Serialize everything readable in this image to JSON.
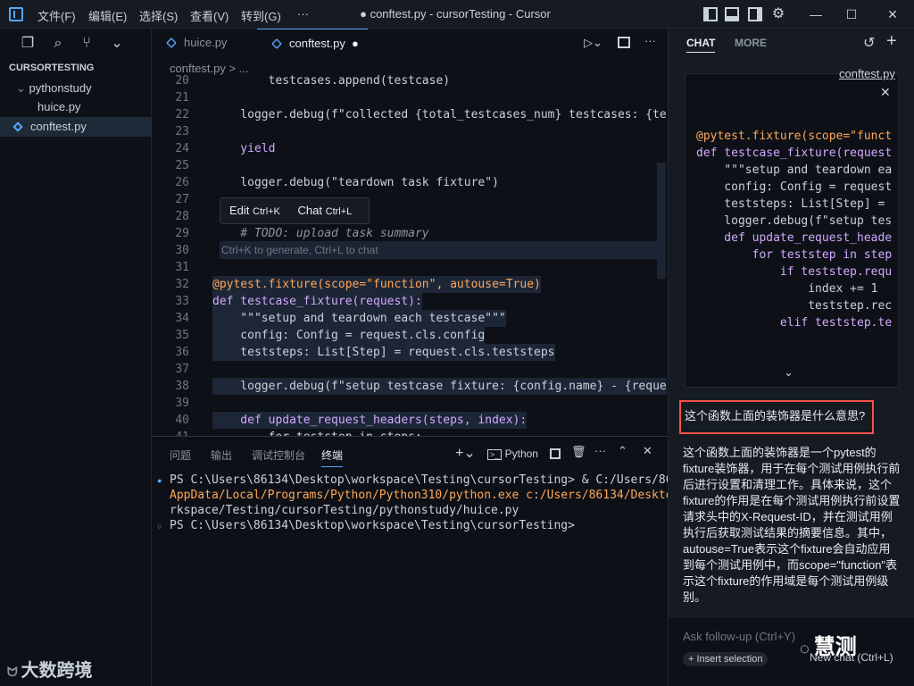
{
  "titlebar": {
    "menus": [
      "文件(F)",
      "编辑(E)",
      "选择(S)",
      "查看(V)",
      "转到(G)",
      "···"
    ],
    "title": "● conftest.py - cursorTesting - Cursor"
  },
  "explorer": {
    "section": "CURSORTESTING",
    "folder": "pythonstudy",
    "files": [
      "huice.py",
      "conftest.py"
    ]
  },
  "editor": {
    "tabs": [
      "huice.py",
      "conftest.py"
    ],
    "breadcrumb": "conftest.py > ...",
    "hint": "Ctrl+K to generate, Ctrl+L to chat",
    "popup": {
      "edit": "Edit",
      "edit_key": "Ctrl+K",
      "chat": "Chat",
      "chat_key": "Ctrl+L"
    },
    "lines": [
      {
        "n": "20",
        "t": "        testcases.append(testcase)"
      },
      {
        "n": "21",
        "t": ""
      },
      {
        "n": "22",
        "t": "    logger.debug(f\"collected {total_testcases_num} testcases: {te"
      },
      {
        "n": "23",
        "t": ""
      },
      {
        "n": "24",
        "t": "    yield"
      },
      {
        "n": "25",
        "t": ""
      },
      {
        "n": "26",
        "t": "    logger.debug(\"teardown task fixture\")"
      },
      {
        "n": "27",
        "t": ""
      },
      {
        "n": "28",
        "t": ""
      },
      {
        "n": "29",
        "t": "    # TODO: upload task summary"
      },
      {
        "n": "30",
        "t": ""
      },
      {
        "n": "31",
        "t": ""
      },
      {
        "n": "32",
        "t": "@pytest.fixture(scope=\"function\", autouse=True)"
      },
      {
        "n": "33",
        "t": "def testcase_fixture(request):"
      },
      {
        "n": "34",
        "t": "    \"\"\"setup and teardown each testcase\"\"\""
      },
      {
        "n": "35",
        "t": "    config: Config = request.cls.config"
      },
      {
        "n": "36",
        "t": "    teststeps: List[Step] = request.cls.teststeps"
      },
      {
        "n": "37",
        "t": ""
      },
      {
        "n": "38",
        "t": "    logger.debug(f\"setup testcase fixture: {config.name} - {reque"
      },
      {
        "n": "39",
        "t": ""
      },
      {
        "n": "40",
        "t": "    def update_request_headers(steps, index):"
      },
      {
        "n": "41",
        "t": "        for teststep in steps:"
      }
    ]
  },
  "terminal": {
    "tabs": [
      "问题",
      "输出",
      "调试控制台",
      "终端"
    ],
    "shell": "Python",
    "lines": [
      "PS C:\\Users\\86134\\Desktop\\workspace\\Testing\\cursorTesting> & C:/Users/86134/",
      "AppData/Local/Programs/Python/Python310/python.exe c:/Users/86134/Desktop/wo",
      "rkspace/Testing/cursorTesting/pythonstudy/huice.py",
      "PS C:\\Users\\86134\\Desktop\\workspace\\Testing\\cursorTesting>"
    ]
  },
  "chat": {
    "tabs": [
      "CHAT",
      "MORE"
    ],
    "file_link": "conftest.py",
    "code": [
      "@pytest.fixture(scope=\"funct",
      "def testcase_fixture(request",
      "    \"\"\"setup and teardown ea",
      "    config: Config = request",
      "    teststeps: List[Step] =",
      "",
      "    logger.debug(f\"setup tes",
      "",
      "    def update_request_heade",
      "        for teststep in step",
      "            if teststep.requ",
      "                index += 1",
      "                teststep.rec",
      "            elif teststep.te"
    ],
    "question": "这个函数上面的装饰器是什么意思?",
    "answer": "这个函数上面的装饰器是一个pytest的fixture装饰器，用于在每个测试用例执行前后进行设置和清理工作。具体来说，这个fixture的作用是在每个测试用例执行前设置请求头中的X-Request-ID，并在测试用例执行后获取测试结果的摘要信息。其中，autouse=True表示这个fixture会自动应用到每个测试用例中，而scope=\"function\"表示这个fixture的作用域是每个测试用例级别。",
    "followup": "Ask follow-up (Ctrl+Y)",
    "insert": "+ Insert selection",
    "newchat": "New chat (Ctrl+L)"
  },
  "watermarks": {
    "left": "大数跨境",
    "right": "慧测"
  },
  "colors": {
    "accent": "#58a6ff",
    "highlight_box": "#f85149"
  }
}
